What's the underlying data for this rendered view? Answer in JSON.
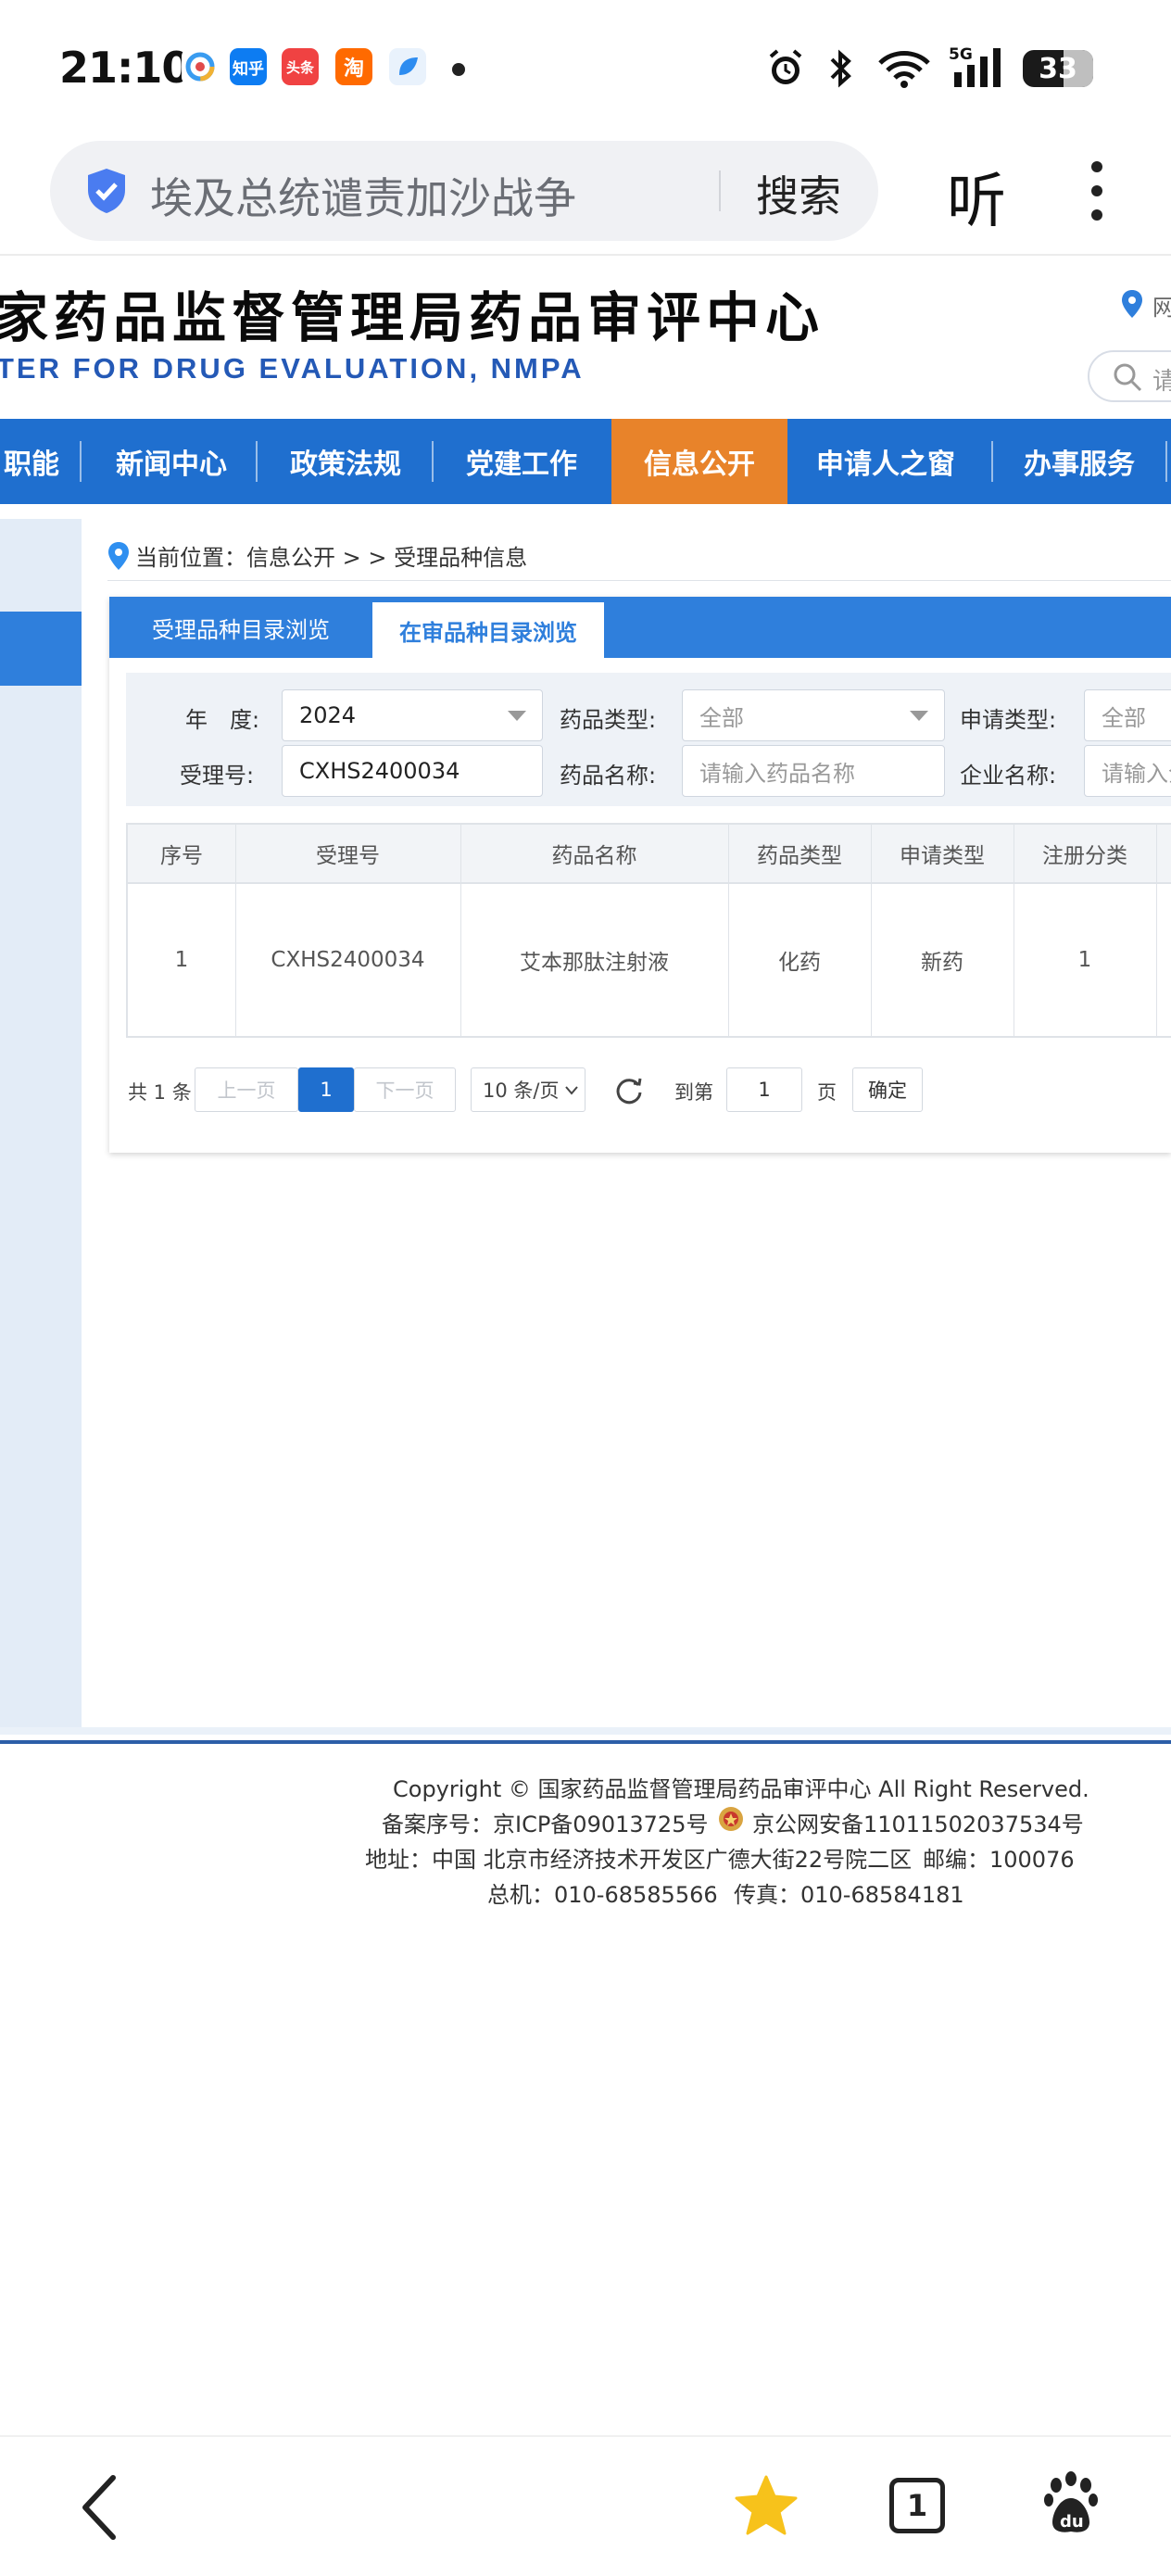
{
  "status_bar": {
    "time": "21:10",
    "apps": [
      "知乎",
      "头条",
      "淘"
    ],
    "battery": "33"
  },
  "browser": {
    "address_text": "埃及总统谴责加沙战争",
    "search_label": "搜索",
    "listen_label": "听"
  },
  "site": {
    "title_cn": "家药品监督管理局药品审评中心",
    "title_en": "TER FOR DRUG EVALUATION, NMPA",
    "location_text": "网",
    "search_placeholder": "请"
  },
  "nav": {
    "items": [
      "职能",
      "新闻中心",
      "政策法规",
      "党建工作",
      "信息公开",
      "申请人之窗",
      "办事服务"
    ],
    "active": "信息公开"
  },
  "breadcrumb": "当前位置：信息公开 > > 受理品种信息",
  "tabs": {
    "tab1": "受理品种目录浏览",
    "tab2": "在审品种目录浏览"
  },
  "filters": {
    "year_label": "年　度:",
    "year_value": "2024",
    "drug_type_label": "药品类型:",
    "drug_type_value": "全部",
    "apply_type_label": "申请类型:",
    "apply_type_value": "全部",
    "accept_no_label": "受理号:",
    "accept_no_value": "CXHS2400034",
    "drug_name_label": "药品名称:",
    "drug_name_placeholder": "请输入药品名称",
    "company_label": "企业名称:",
    "company_placeholder": "请输入企"
  },
  "table": {
    "headers": [
      "序号",
      "受理号",
      "药品名称",
      "药品类型",
      "申请类型",
      "注册分类"
    ],
    "rows": [
      [
        "1",
        "CXHS2400034",
        "艾本那肽注射液",
        "化药",
        "新药",
        "1"
      ]
    ]
  },
  "pagination": {
    "total": "共 1 条",
    "prev": "上一页",
    "current": "1",
    "next": "下一页",
    "page_size": "10 条/页",
    "goto_label": "到第",
    "goto_value": "1",
    "page_unit": "页",
    "confirm": "确定"
  },
  "footer": {
    "copyright": "Copyright © 国家药品监督管理局药品审评中心   All Right Reserved.",
    "icp": "备案序号：京ICP备09013725号",
    "police": "京公网安备11011502037534号",
    "address": "地址：中国 北京市经济技术开发区广德大街22号院二区",
    "postcode": "邮编：100076",
    "phone": "总机：010-68585566",
    "fax": "传真：010-68584181"
  },
  "bottom_nav": {
    "tab_count": "1"
  },
  "colors": {
    "nav_blue": "#1f6fcf",
    "nav_active": "#e8832a",
    "tab_blue": "#2f7fdc",
    "page_active": "#1f6fcf",
    "en_title": "#2459b6"
  }
}
